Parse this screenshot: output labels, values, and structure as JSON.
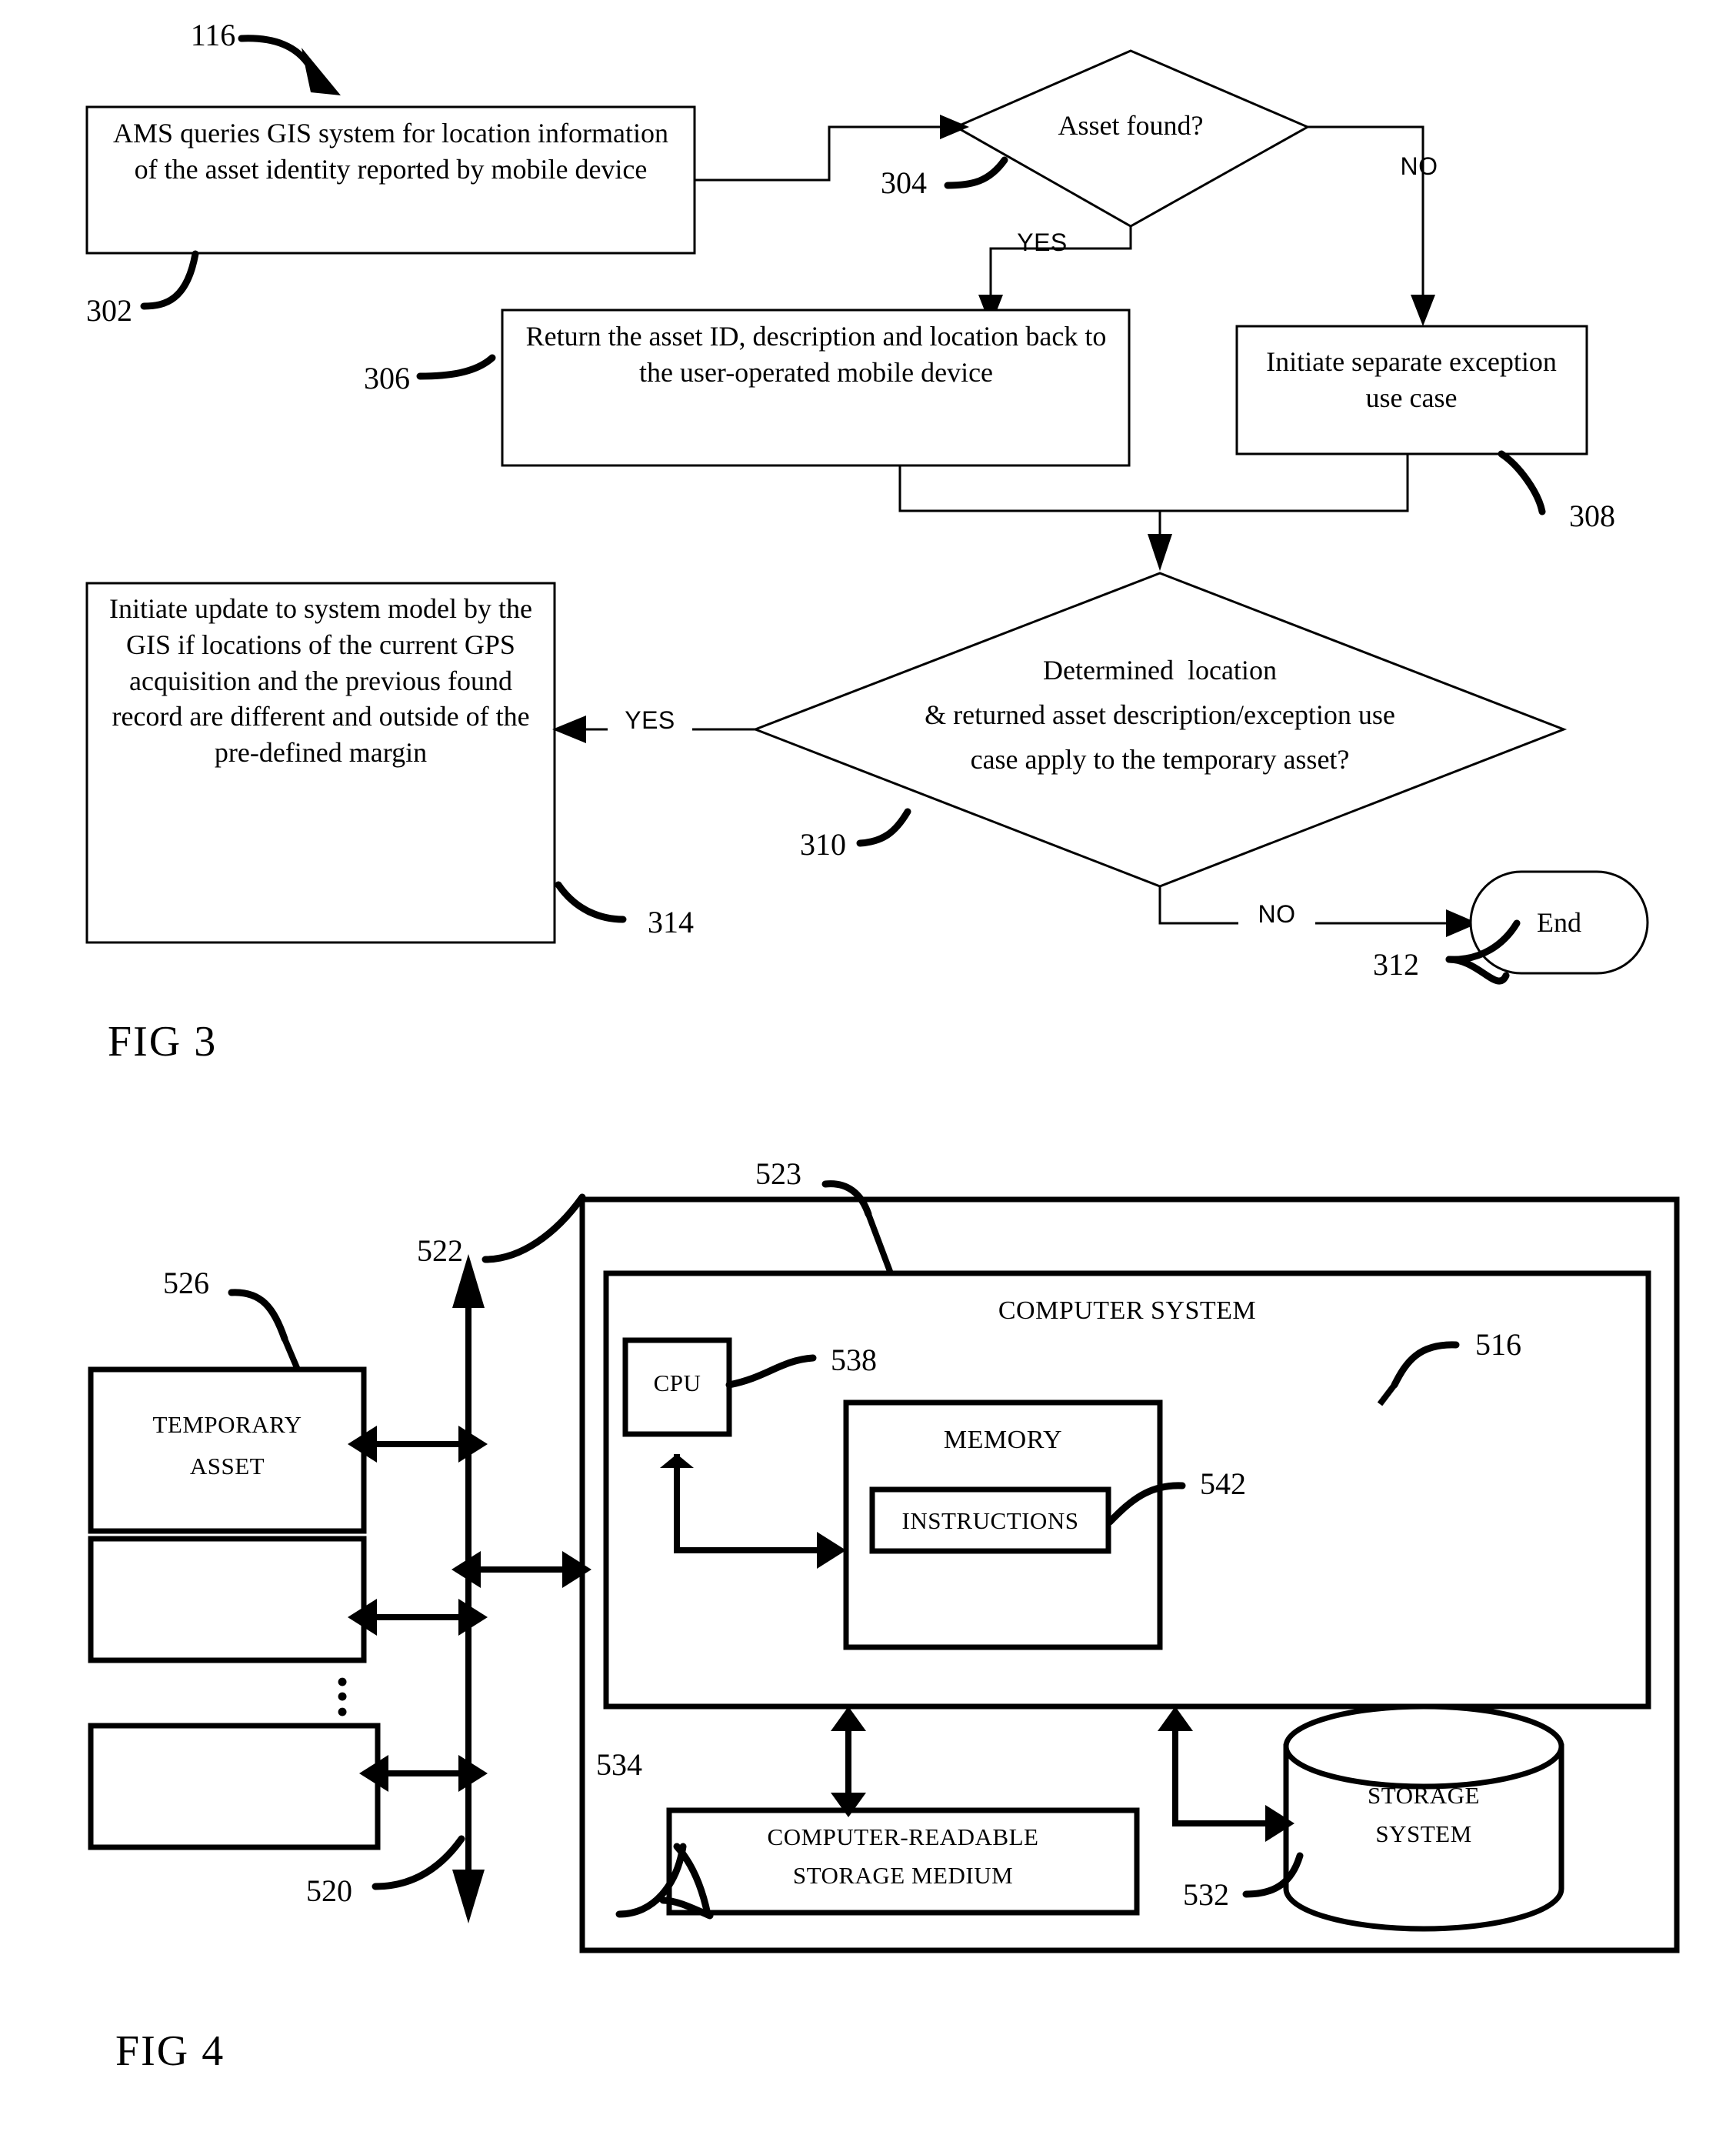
{
  "document": {
    "type": "patent-drawing-sheet",
    "figures": [
      {
        "id": "fig3",
        "label": "FIG 3"
      },
      {
        "id": "fig4",
        "label": "FIG 4"
      }
    ]
  },
  "fig3": {
    "label": "FIG 3",
    "flow_ref": "116",
    "nodes": {
      "n302": {
        "ref": "302",
        "shape": "process",
        "text": "AMS queries GIS system for location information of the asset identity reported by mobile device"
      },
      "n304": {
        "ref": "304",
        "shape": "decision",
        "text": "Asset found?"
      },
      "n306": {
        "ref": "306",
        "shape": "process",
        "text": "Return the asset ID, description and location back to the user-operated mobile device"
      },
      "n308": {
        "ref": "308",
        "shape": "process",
        "text": "Initiate separate exception use case"
      },
      "n310": {
        "ref": "310",
        "shape": "decision",
        "line1": "Determined  location",
        "line2": "& returned asset description/exception use",
        "line3": "case apply to the temporary asset?"
      },
      "n312": {
        "ref": "312",
        "shape": "terminator",
        "text": "End"
      },
      "n314": {
        "ref": "314",
        "shape": "process",
        "text": "Initiate update to system model by the GIS if locations of the current GPS acquisition and the previous found record are different and outside of the pre-defined margin"
      }
    },
    "edge_labels": {
      "yes_304": "YES",
      "no_304": "NO",
      "yes_310": "YES",
      "no_310": "NO"
    }
  },
  "fig4": {
    "label": "FIG 4",
    "refs": {
      "outer_enclosure": "522",
      "computer_system": "523",
      "bus": "520",
      "temporary_asset": "526",
      "cpu": "538",
      "memory": "516",
      "instructions": "542",
      "storage_system": "532",
      "crsm": "534"
    },
    "blocks": {
      "temporary_asset": {
        "line1": "TEMPORARY",
        "line2": "ASSET"
      },
      "peripheral_2": {
        "line1": "",
        "line2": ""
      },
      "peripheral_3": {
        "line1": "",
        "line2": ""
      },
      "computer_system": {
        "title": "COMPUTER SYSTEM"
      },
      "cpu": {
        "title": "CPU"
      },
      "memory": {
        "title": "MEMORY"
      },
      "instructions": {
        "title": "INSTRUCTIONS"
      },
      "crsm": {
        "line1": "COMPUTER-READABLE",
        "line2": "STORAGE MEDIUM"
      },
      "storage_system": {
        "line1": "STORAGE",
        "line2": "SYSTEM"
      }
    },
    "vertical_ellipsis": "•\n•\n•"
  },
  "colors": {
    "ink": "#000000",
    "paper": "#ffffff"
  }
}
